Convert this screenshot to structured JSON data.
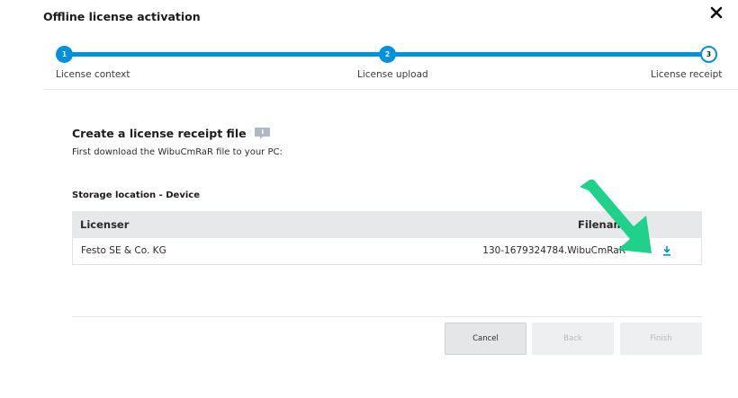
{
  "dialog": {
    "title": "Offline license activation"
  },
  "stepper": {
    "steps": [
      {
        "number": "1",
        "label": "License context",
        "state": "done"
      },
      {
        "number": "2",
        "label": "License upload",
        "state": "done"
      },
      {
        "number": "3",
        "label": "License receipt",
        "state": "active"
      }
    ],
    "accent_color": "#0091dc"
  },
  "content": {
    "section_title": "Create a license receipt file",
    "instruction": "First download the WibuCmRaR file to your PC:",
    "storage_title": "Storage location - Device"
  },
  "table": {
    "columns": [
      "Licenser",
      "Filename"
    ],
    "rows": [
      {
        "licenser": "Festo SE & Co. KG",
        "filename": "130-1679324784.WibuCmRaR"
      }
    ]
  },
  "icons": {
    "close": "close-icon",
    "info": "info-icon",
    "download": "download-icon",
    "annotation": "green-arrow-icon"
  },
  "buttons": {
    "cancel": "Cancel",
    "back": "Back",
    "finish": "Finish"
  },
  "annotation_color": "#1fd18a"
}
